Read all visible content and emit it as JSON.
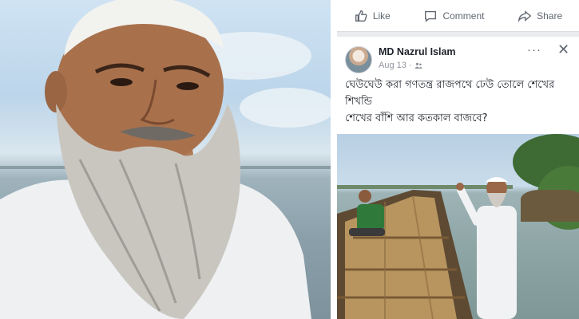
{
  "actions": {
    "like_label": "Like",
    "comment_label": "Comment",
    "share_label": "Share"
  },
  "post": {
    "author": "MD Nazrul Islam",
    "date": "Aug 13",
    "privacy_icon": "friends-icon",
    "more_icon": "more-options-icon",
    "close_glyph": "✕",
    "more_glyph": "···",
    "text_lines": [
      "ঘেউঘেউ  করা গণতন্ত্র  রাজপথে ঢেউ তোলে শেখের",
      "শিখন্ডি",
      "শেখের বাঁশি আর কতকাল বাজবে?"
    ]
  },
  "colors": {
    "fb_text": "#1d2129",
    "fb_meta": "#90949c",
    "fb_action": "#606770",
    "divider_band": "#e9ebee"
  }
}
